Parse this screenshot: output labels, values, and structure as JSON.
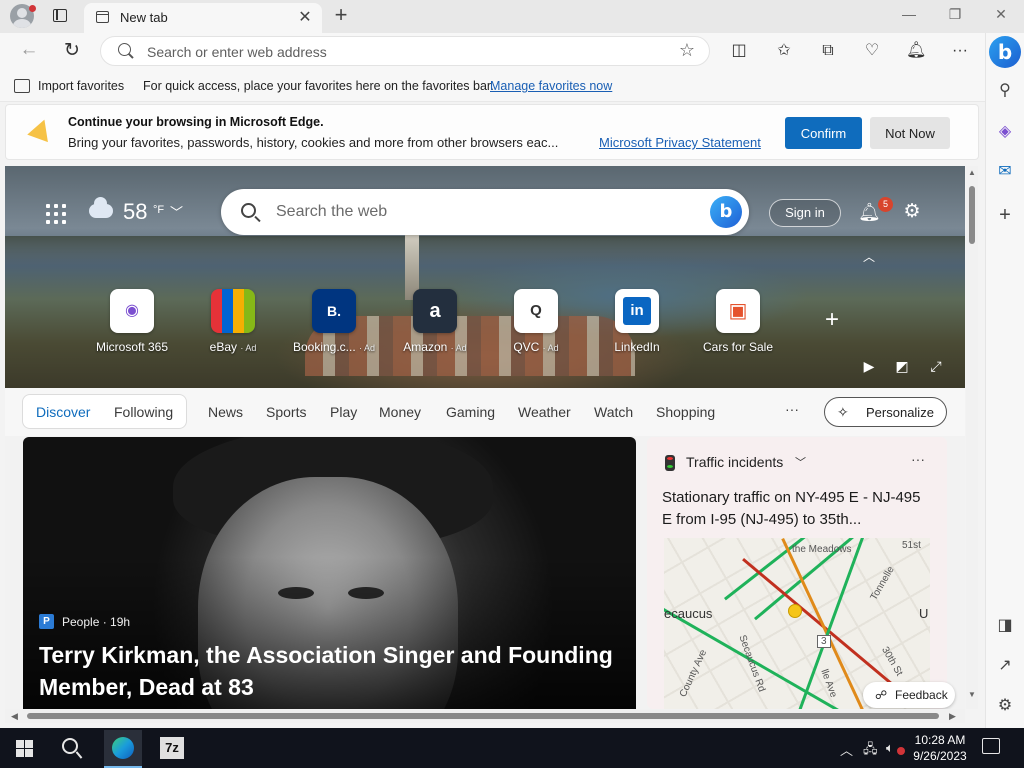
{
  "browser": {
    "tab_title": "New tab",
    "address_placeholder": "Search or enter web address"
  },
  "favorites_bar": {
    "import_label": "Import favorites",
    "hint": "For quick access, place your favorites here on the favorites bar.",
    "manage_link": "Manage favorites now"
  },
  "infobar": {
    "title": "Continue your browsing in Microsoft Edge.",
    "body": "Bring your favorites, passwords, history, cookies and more from other browsers eac...",
    "link": "Microsoft Privacy Statement",
    "confirm_label": "Confirm",
    "not_now_label": "Not Now",
    "accent_color": "#0f6cbd"
  },
  "newtab": {
    "weather": {
      "temp": "58",
      "unit": "°F",
      "icon": "cloud-icon"
    },
    "search_placeholder": "Search the web",
    "sign_in_label": "Sign in",
    "notification_count": "5",
    "quick_links": [
      {
        "label": "Microsoft 365",
        "ad": "",
        "icon": "M"
      },
      {
        "label": "eBay",
        "ad": "· Ad",
        "icon": "▦"
      },
      {
        "label": "Booking.c...",
        "ad": "· Ad",
        "icon": "B."
      },
      {
        "label": "Amazon",
        "ad": "· Ad",
        "icon": "a"
      },
      {
        "label": "QVC",
        "ad": "· Ad",
        "icon": "Q"
      },
      {
        "label": "LinkedIn",
        "ad": "",
        "icon": "in"
      },
      {
        "label": "Cars for Sale",
        "ad": "",
        "icon": "🚗"
      }
    ]
  },
  "feed_nav": {
    "tabs": [
      "Discover",
      "Following",
      "News",
      "Sports",
      "Play",
      "Money",
      "Gaming",
      "Weather",
      "Watch",
      "Shopping"
    ],
    "more_label": "···",
    "personalize_label": "Personalize"
  },
  "main_story": {
    "source_badge": "P",
    "source": "People · 19h",
    "title": "Terry Kirkman, the Association Singer and Founding Member, Dead at 83"
  },
  "traffic_card": {
    "title": "Traffic incidents",
    "description": "Stationary traffic on NY-495 E - NJ-495 E from I-95 (NJ-495) to 35th...",
    "map_labels": [
      "ecaucus",
      "the Meadows",
      "51st",
      "Tonnelle",
      "30th St",
      "Secaucus Rd",
      "County Ave",
      "lle Ave",
      "3",
      "U"
    ]
  },
  "feedback_label": "Feedback",
  "taskbar": {
    "time": "10:28 AM",
    "date": "9/26/2023",
    "app_7z_label": "7z"
  }
}
